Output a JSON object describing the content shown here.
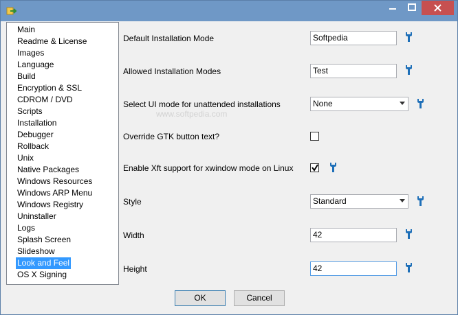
{
  "window": {
    "minimize_glyph": "minimize-icon",
    "maximize_glyph": "maximize-icon",
    "close_glyph": "close-icon"
  },
  "sidebar": {
    "items": [
      {
        "label": "Main"
      },
      {
        "label": "Readme & License"
      },
      {
        "label": "Images"
      },
      {
        "label": "Language"
      },
      {
        "label": "Build"
      },
      {
        "label": "Encryption & SSL"
      },
      {
        "label": "CDROM / DVD"
      },
      {
        "label": "Scripts"
      },
      {
        "label": "Installation"
      },
      {
        "label": "Debugger"
      },
      {
        "label": "Rollback"
      },
      {
        "label": "Unix"
      },
      {
        "label": "Native Packages"
      },
      {
        "label": "Windows Resources"
      },
      {
        "label": "Windows ARP Menu"
      },
      {
        "label": "Windows Registry"
      },
      {
        "label": "Uninstaller"
      },
      {
        "label": "Logs"
      },
      {
        "label": "Splash Screen"
      },
      {
        "label": "Slideshow"
      },
      {
        "label": "Look and Feel"
      },
      {
        "label": "OS X Signing"
      }
    ],
    "selected": "Look and Feel"
  },
  "settings": {
    "default_mode": {
      "label": "Default Installation Mode",
      "value": "Softpedia"
    },
    "allowed_modes": {
      "label": "Allowed Installation Modes",
      "value": "Test"
    },
    "unattended_ui": {
      "label": "Select UI mode for unattended installations",
      "value": "None"
    },
    "gtk_override": {
      "label": "Override GTK button text?",
      "checked": false
    },
    "xft_support": {
      "label": "Enable Xft support for xwindow mode on Linux",
      "checked": true
    },
    "style": {
      "label": "Style",
      "value": "Standard"
    },
    "width": {
      "label": "Width",
      "value": "42"
    },
    "height": {
      "label": "Height",
      "value": "42"
    }
  },
  "watermark": "www.softpedia.com",
  "buttons": {
    "ok": "OK",
    "cancel": "Cancel"
  },
  "colors": {
    "titlebar": "#6f98c6",
    "close": "#c75050",
    "selection": "#3399ff",
    "wrench": "#1e6fb8"
  }
}
